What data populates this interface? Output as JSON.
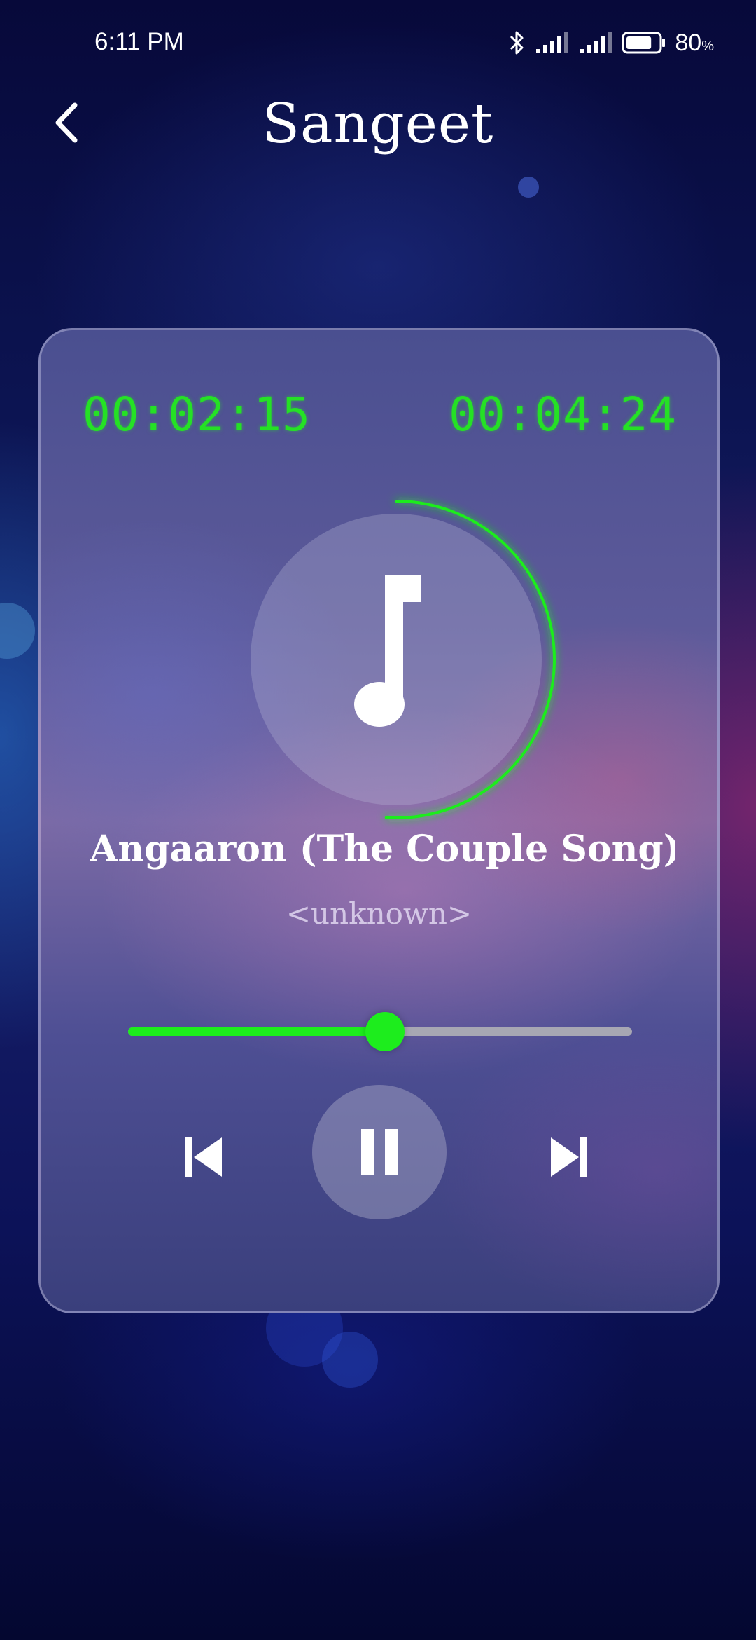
{
  "status_bar": {
    "time": "6:11 PM",
    "battery_level": "80",
    "battery_unit": "%",
    "battery_fraction": 0.8
  },
  "header": {
    "title": "Sangeet"
  },
  "player": {
    "elapsed_time": "00:02:15",
    "total_time": "00:04:24",
    "song_title": "Angaaron (The Couple Song) Lyrics",
    "artist": "<unknown>",
    "progress_fraction": 0.51
  },
  "colors": {
    "accent": "#1ded1d",
    "digits": "#25e125"
  },
  "icons": {
    "back": "chevron-left-icon",
    "note": "music-note-icon",
    "prev": "skip-previous-icon",
    "pause": "pause-icon",
    "next": "skip-next-icon"
  }
}
